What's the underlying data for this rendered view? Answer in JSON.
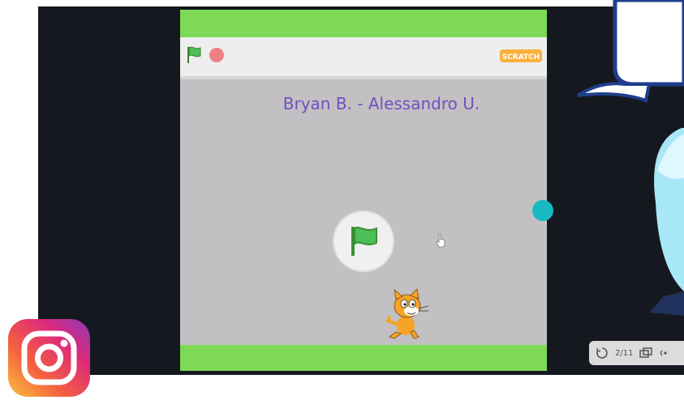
{
  "stage": {
    "title": "Bryan B. - Alessandro U.",
    "logo_text": "SCRATCH"
  },
  "controls": {
    "green_flag": "green-flag-icon",
    "stop": "stop-icon"
  },
  "colors": {
    "green_band": "#7ed957",
    "stage_bg": "#c2c0c2",
    "title": "#6c52bf",
    "teal": "#18b9c2",
    "frame": "#15191f"
  },
  "slides": {
    "counter": "2/11"
  }
}
